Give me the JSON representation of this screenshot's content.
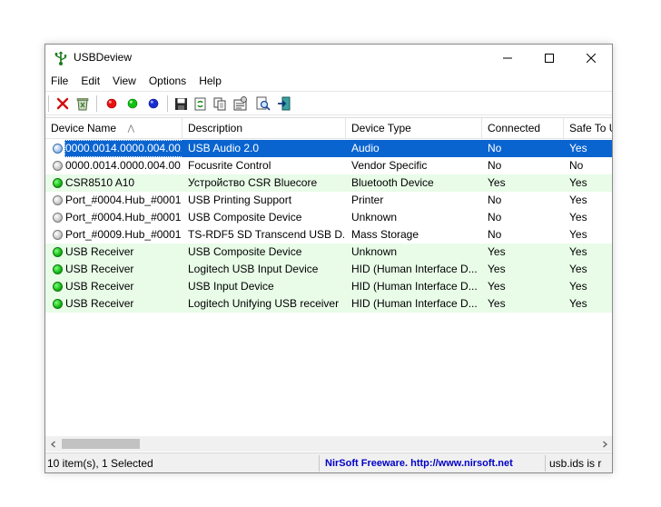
{
  "window": {
    "title": "USBDeview"
  },
  "menu": [
    "File",
    "Edit",
    "View",
    "Options",
    "Help"
  ],
  "toolbar": {
    "buttons": [
      "disconnect-icon",
      "uninstall-icon",
      "red-dot-icon",
      "green-dot-icon",
      "blue-dot-icon",
      "save-icon",
      "refresh-icon",
      "copy-icon",
      "properties-icon",
      "find-icon",
      "exit-icon"
    ]
  },
  "columns": {
    "device_name": "Device Name",
    "description": "Description",
    "device_type": "Device Type",
    "connected": "Connected",
    "safe_to_unplug": "Safe To U"
  },
  "rows": [
    {
      "name": "0000.0014.0000.004.00...",
      "description": "USB Audio 2.0",
      "type": "Audio",
      "connected": "No",
      "safe": "Yes",
      "status": "blue"
    },
    {
      "name": "0000.0014.0000.004.00...",
      "description": "Focusrite Control",
      "type": "Vendor Specific",
      "connected": "No",
      "safe": "No",
      "status": "gray"
    },
    {
      "name": "CSR8510 A10",
      "description": "Устройство CSR Bluecore",
      "type": "Bluetooth Device",
      "connected": "Yes",
      "safe": "Yes",
      "status": "green"
    },
    {
      "name": "Port_#0004.Hub_#0001",
      "description": "USB Printing Support",
      "type": "Printer",
      "connected": "No",
      "safe": "Yes",
      "status": "gray"
    },
    {
      "name": "Port_#0004.Hub_#0001",
      "description": "USB Composite Device",
      "type": "Unknown",
      "connected": "No",
      "safe": "Yes",
      "status": "gray"
    },
    {
      "name": "Port_#0009.Hub_#0001",
      "description": "TS-RDF5 SD  Transcend USB D...",
      "type": "Mass Storage",
      "connected": "No",
      "safe": "Yes",
      "status": "gray"
    },
    {
      "name": "USB Receiver",
      "description": "USB Composite Device",
      "type": "Unknown",
      "connected": "Yes",
      "safe": "Yes",
      "status": "green"
    },
    {
      "name": "USB Receiver",
      "description": "Logitech USB Input Device",
      "type": "HID (Human Interface D...",
      "connected": "Yes",
      "safe": "Yes",
      "status": "green"
    },
    {
      "name": "USB Receiver",
      "description": "USB Input Device",
      "type": "HID (Human Interface D...",
      "connected": "Yes",
      "safe": "Yes",
      "status": "green"
    },
    {
      "name": "USB Receiver",
      "description": "Logitech Unifying USB receiver",
      "type": "HID (Human Interface D...",
      "connected": "Yes",
      "safe": "Yes",
      "status": "green"
    }
  ],
  "selected_row": 0,
  "status": {
    "count": "10 item(s), 1 Selected",
    "nirsoft": "NirSoft Freeware.  http://www.nirsoft.net",
    "usbids": "usb.ids is r"
  },
  "colors": {
    "selection": "#0a64d0",
    "connected_row": "#e8fce8",
    "link": "#0000c8"
  }
}
